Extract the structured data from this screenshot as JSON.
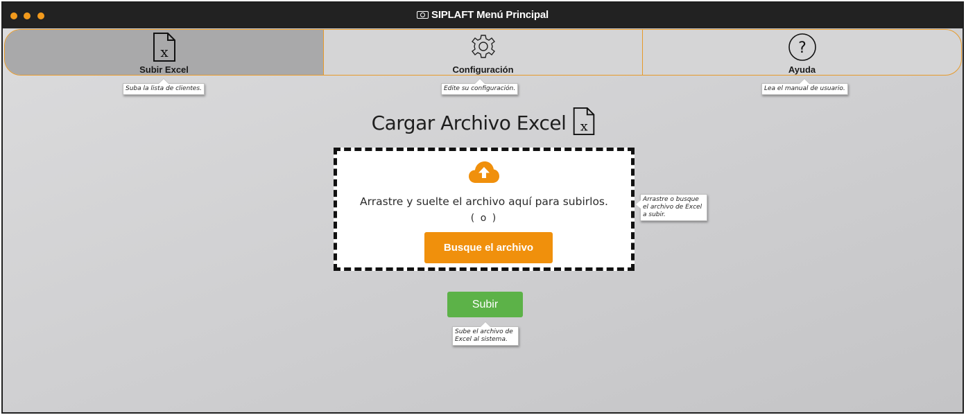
{
  "window": {
    "title": "SIPLAFT Menú Principal"
  },
  "nav": {
    "items": [
      {
        "label": "Subir Excel",
        "tooltip": "Suba la lista de clientes.",
        "icon": "excel-file-icon",
        "active": true
      },
      {
        "label": "Configuración",
        "tooltip": "Edite su configuración.",
        "icon": "gear-icon",
        "active": false
      },
      {
        "label": "Ayuda",
        "tooltip": "Lea el manual de usuario.",
        "icon": "help-icon",
        "active": false
      }
    ]
  },
  "main": {
    "heading": "Cargar Archivo Excel",
    "dropzone": {
      "text": "Arrastre y suelte el archivo aquí para subirlos.",
      "or": "( o )",
      "browse_label": "Busque el archivo",
      "tooltip": "Arrastre o busque el archivo de Excel a subir."
    },
    "submit_label": "Subir",
    "submit_tooltip": "Sube el archivo de Excel al sistema."
  },
  "colors": {
    "accent": "#f0900c",
    "success": "#5cb248",
    "titlebar": "#222222"
  }
}
